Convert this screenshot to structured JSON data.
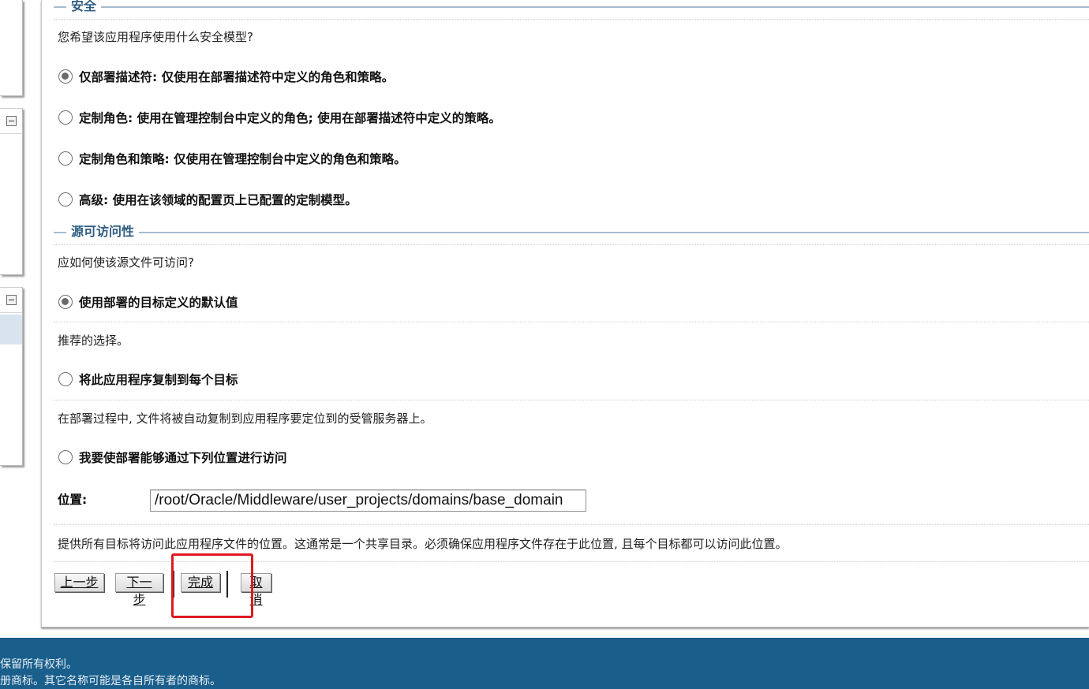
{
  "sections": {
    "security": {
      "title": "安全",
      "question": "您希望该应用程序使用什么安全模型?",
      "options": [
        {
          "label": "仅部署描述符: 仅使用在部署描述符中定义的角色和策略。",
          "checked": true
        },
        {
          "label": "定制角色: 使用在管理控制台中定义的角色; 使用在部署描述符中定义的策略。",
          "checked": false
        },
        {
          "label": "定制角色和策略: 仅使用在管理控制台中定义的角色和策略。",
          "checked": false
        },
        {
          "label": "高级: 使用在该领域的配置页上已配置的定制模型。",
          "checked": false
        }
      ]
    },
    "source_accessibility": {
      "title": "源可访问性",
      "question": "应如何使该源文件可访问?",
      "options": [
        {
          "label": "使用部署的目标定义的默认值",
          "checked": true,
          "help": "推荐的选择。"
        },
        {
          "label": "将此应用程序复制到每个目标",
          "checked": false,
          "help": "在部署过程中, 文件将被自动复制到应用程序要定位到的受管服务器上。"
        },
        {
          "label": "我要使部署能够通过下列位置进行访问",
          "checked": false,
          "help": "提供所有目标将访问此应用程序文件的位置。这通常是一个共享目录。必须确保应用程序文件存在于此位置, 且每个目标都可以访问此位置。"
        }
      ],
      "location_label": "位置:",
      "location_value": "/root/Oracle/Middleware/user_projects/domains/base_domain"
    }
  },
  "buttons": {
    "prev": "上一步",
    "next": "下一步",
    "finish": "完成",
    "cancel": "取消"
  },
  "footer": {
    "line1": "保留所有权利。",
    "line2": "册商标。其它名称可能是各自所有者的商标。"
  },
  "colors": {
    "section_title": "#2f5d83",
    "footer_bg": "#1a5f8c",
    "highlight": "#e0191f"
  }
}
